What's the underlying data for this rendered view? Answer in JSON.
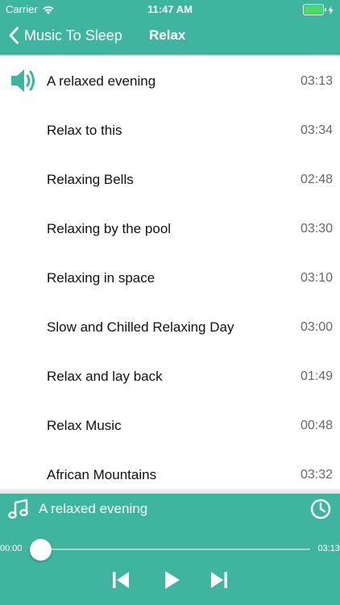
{
  "status_bar": {
    "carrier": "Carrier",
    "time": "11:47 AM",
    "battery_color": "#4cd964"
  },
  "nav": {
    "back_label": "Music To Sleep",
    "back_icon": "chevron-left-icon",
    "title": "Relax"
  },
  "colors": {
    "accent": "#3fb5a0",
    "text": "#111111",
    "duration": "#666666"
  },
  "tracks": [
    {
      "title": "A relaxed evening",
      "duration": "03:13",
      "playing": true
    },
    {
      "title": "Relax to this",
      "duration": "03:34",
      "playing": false
    },
    {
      "title": "Relaxing Bells",
      "duration": "02:48",
      "playing": false
    },
    {
      "title": "Relaxing by the pool",
      "duration": "03:30",
      "playing": false
    },
    {
      "title": "Relaxing in space",
      "duration": "03:10",
      "playing": false
    },
    {
      "title": "Slow and Chilled Relaxing Day",
      "duration": "03:00",
      "playing": false
    },
    {
      "title": "Relax and lay back",
      "duration": "01:49",
      "playing": false
    },
    {
      "title": "Relax Music",
      "duration": "00:48",
      "playing": false
    },
    {
      "title": "African Mountains",
      "duration": "03:32",
      "playing": false
    }
  ],
  "player": {
    "now_playing": "A relaxed evening",
    "elapsed": "00:00",
    "remaining": "03:13",
    "progress": 0,
    "icons": [
      "music-note-icon",
      "clock-icon",
      "skip-back-icon",
      "play-icon",
      "skip-forward-icon"
    ]
  }
}
